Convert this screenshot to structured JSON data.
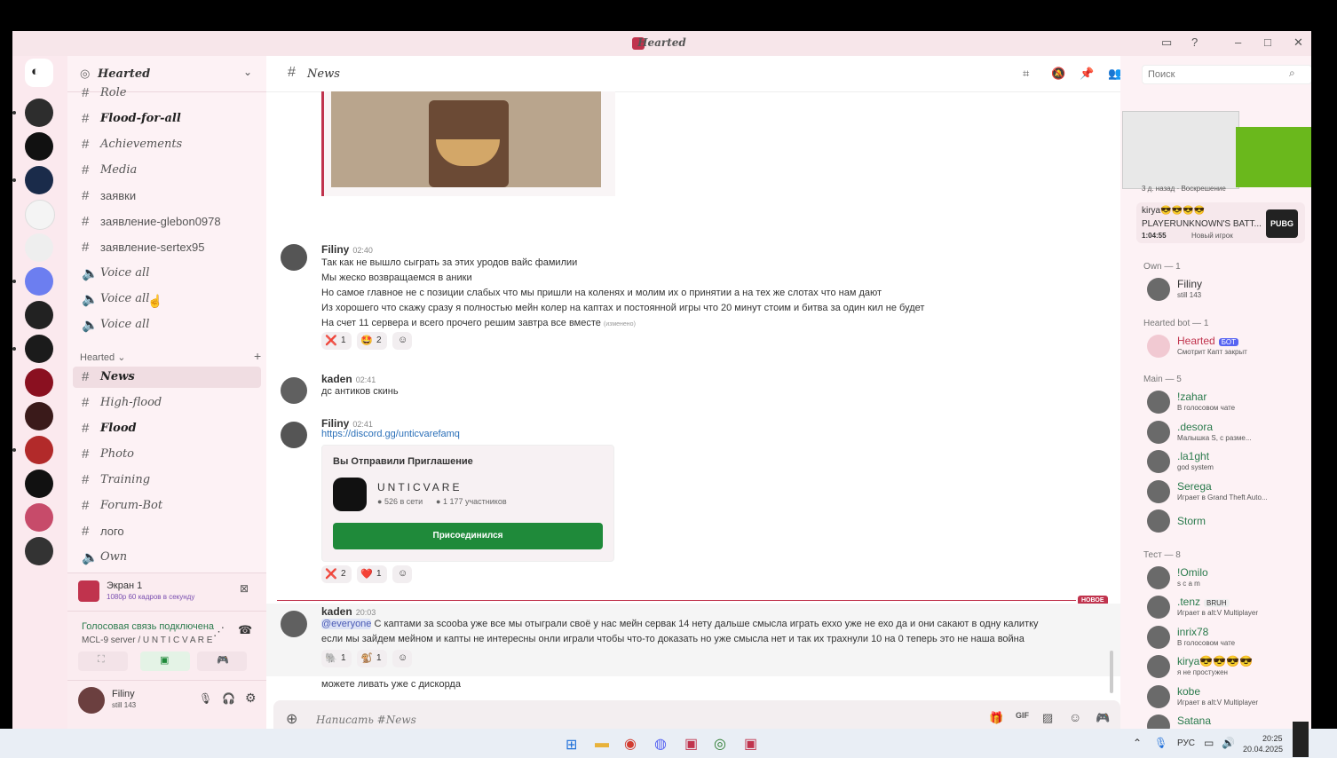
{
  "window": {
    "title": "Hearted"
  },
  "guild": {
    "name": "Hearted"
  },
  "channels": {
    "top": [
      {
        "sym": "#",
        "label": "Role",
        "bold": false
      },
      {
        "sym": "#",
        "label": "Flood-for-all",
        "bold": true
      },
      {
        "sym": "#",
        "label": "Achievements",
        "bold": false
      },
      {
        "sym": "#",
        "label": "Media",
        "bold": false
      },
      {
        "sym": "#",
        "label": "заявки",
        "bold": false
      },
      {
        "sym": "#",
        "label": "заявление-glebon0978",
        "bold": false
      },
      {
        "sym": "#",
        "label": "заявление-sertex95",
        "bold": false
      },
      {
        "sym": "🔈",
        "label": "Voice all",
        "bold": false
      },
      {
        "sym": "🔈",
        "label": "Voice all",
        "bold": false
      },
      {
        "sym": "🔈",
        "label": "Voice all",
        "bold": false
      }
    ],
    "category": "Hearted",
    "bottom": [
      {
        "sym": "#",
        "label": "News",
        "bold": true,
        "selected": true
      },
      {
        "sym": "#",
        "label": "High-flood",
        "bold": false
      },
      {
        "sym": "#",
        "label": "Flood",
        "bold": true
      },
      {
        "sym": "#",
        "label": "Photo",
        "bold": false
      },
      {
        "sym": "#",
        "label": "Training",
        "bold": false
      },
      {
        "sym": "#",
        "label": "Forum-Bot",
        "bold": false
      },
      {
        "sym": "#",
        "label": "лого",
        "bold": false
      },
      {
        "sym": "🔈",
        "label": "Own",
        "bold": false
      }
    ]
  },
  "stream": {
    "title": "Экран 1",
    "detail": "1080p 60 кадров в секунду"
  },
  "voice": {
    "status": "Голосовая связь подключена",
    "server": "MCL-9 server / U N T I C V A R E"
  },
  "user": {
    "name": "Filiny",
    "status": "still 143"
  },
  "header": {
    "channel": "News",
    "search_placeholder": "Поиск"
  },
  "messages": {
    "m1": {
      "author": "Filiny",
      "time": "02:40",
      "lines": [
        "Так как не вышло сыграть за этих уродов вайс фамилии",
        "Мы жеско возвращаемся в аники",
        "Но самое главное не с позиции слабых что мы пришли на коленях и молим их о принятии а на тех же слотах что нам дают",
        "Из хорошего что скажу сразу я полностью мейн колер на каптах и постоянной игры что 20 минут стоим и битва за один кил не будет",
        "На счет 11 сервера и всего прочего решим завтра все вместе"
      ],
      "edited": "(изменено)",
      "reactions": [
        {
          "emoji": "❌",
          "count": "1"
        },
        {
          "emoji": "🤩",
          "count": "2"
        }
      ]
    },
    "m2": {
      "author": "kaden",
      "time": "02:41",
      "text": "дс антиков скинь"
    },
    "m3": {
      "author": "Filiny",
      "time": "02:41",
      "link": "https://discord.gg/unticvarefamq",
      "invite": {
        "heading": "Вы Отправили Приглашение",
        "server": "UNTICVARE",
        "online": "526 в сети",
        "members": "1 177 участников",
        "button": "Присоединился"
      },
      "reactions": [
        {
          "emoji": "❌",
          "count": "2"
        },
        {
          "emoji": "❤️",
          "count": "1"
        }
      ]
    },
    "new_label": "НОВОЕ",
    "m4": {
      "author": "kaden",
      "time": "20:03",
      "mention": "@everyone",
      "text1": " С каптами за scooba уже все мы отыграли своё у нас мейн сервак 14 нету дальше смысла играть еххо уже не ехо да и они  сакают в одну калитку",
      "text2": "если мы зайдем мейном и капты не интересны онли играли чтобы что-то доказать но уже смысла нет и так их трахнули 10 на 0 теперь это не наша война",
      "reactions": [
        {
          "emoji": "🐘",
          "count": "1"
        },
        {
          "emoji": "🐒",
          "count": "1"
        }
      ]
    },
    "m5": {
      "text": "можете ливать уже с дискорда"
    }
  },
  "composer": {
    "placeholder": "Написать #News"
  },
  "members": {
    "activity": {
      "header": "3 д. назад · Воскрешение",
      "name": "kirya😎😎😎😎",
      "game": "PLAYERUNKNOWN'S BATT...",
      "time": "1:04:55",
      "note": "Новый игрок",
      "badge": "PUBG"
    },
    "groups": [
      {
        "title": "Own — 1",
        "items": [
          {
            "name": "Filiny",
            "status": "still 143",
            "color": "#333333"
          }
        ]
      },
      {
        "title": "Hearted bot — 1",
        "items": [
          {
            "name": "Hearted",
            "tag": "БОТ",
            "status": "Смотрит Капт закрыт",
            "color": "#c0334d"
          }
        ]
      },
      {
        "title": "Main — 5",
        "items": [
          {
            "name": "!zahar",
            "status": "В голосовом чате",
            "color": "#2a7a4c"
          },
          {
            "name": ".desora",
            "status": "Малышка S, с разме...",
            "color": "#2a7a4c"
          },
          {
            "name": ".la1ght",
            "status": "god system",
            "color": "#2a7a4c"
          },
          {
            "name": "Serega",
            "status": "Играет в Grand Theft Auto...",
            "color": "#2a7a4c"
          },
          {
            "name": "Storm",
            "status": "",
            "color": "#2a7a4c"
          }
        ]
      },
      {
        "title": "Тест — 8",
        "items": [
          {
            "name": "!Omilo",
            "status": "s c a m",
            "color": "#2a7a4c"
          },
          {
            "name": ".tenz",
            "tag": "BRUH",
            "status": "Играет в alt:V Multiplayer",
            "color": "#2a7a4c"
          },
          {
            "name": "inrix78",
            "status": "В голосовом чате",
            "color": "#2a7a4c"
          },
          {
            "name": "kirya😎😎😎😎",
            "status": "я не простужен",
            "color": "#2a7a4c"
          },
          {
            "name": "kobe",
            "status": "Играет в alt:V Multiplayer",
            "color": "#2a7a4c"
          },
          {
            "name": "Satana",
            "status": "Играет в Counter-Strike 2",
            "color": "#2a7a4c"
          }
        ]
      }
    ]
  },
  "taskbar": {
    "lang": "РУС",
    "time": "20:25",
    "date": "20.04.2025"
  },
  "colors": {
    "accent": "#c0334d",
    "join": "#1f8a3a",
    "bg": "#fdf2f5"
  }
}
